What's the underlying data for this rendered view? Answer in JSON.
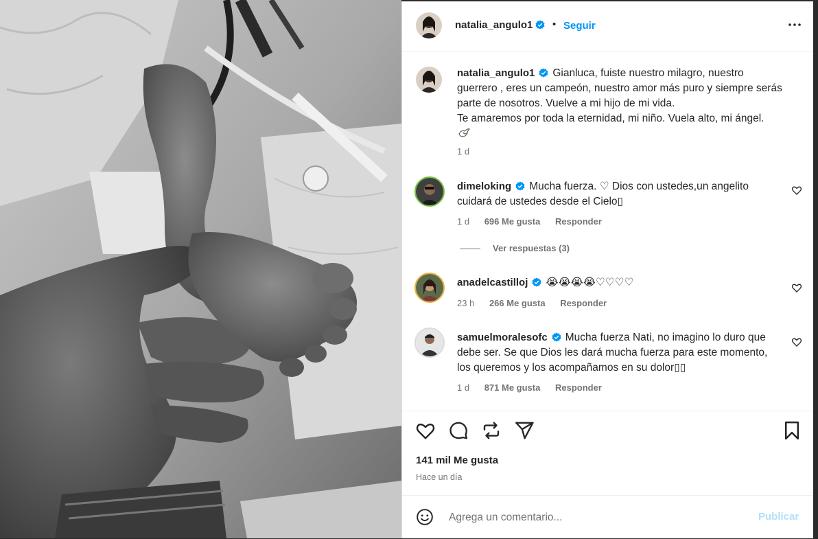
{
  "post": {
    "author": "natalia_angulo1",
    "follow_label": "Seguir",
    "separator": "•",
    "more_icon": "more-horizontal-icon"
  },
  "caption": {
    "author": "natalia_angulo1",
    "text": "Gianluca, fuiste nuestro milagro, nuestro guerrero , eres un campeón, nuestro amor más puro y siempre serás parte de nosotros. Vuelve a mi hijo de mi vida.\nTe amaremos por toda la eternidad, mi niño. Vuela alto, mi ángel.",
    "time": "1 d"
  },
  "comments": [
    {
      "user": "dimeloking",
      "text": "Mucha fuerza. ♡ Dios con ustedes,un angelito cuidará de ustedes desde el Cielo",
      "time": "1 d",
      "likes": "696 Me gusta",
      "reply": "Responder"
    },
    {
      "user": "anadelcastilloj",
      "text": "😭😭😭😭♡♡♡♡",
      "time": "23 h",
      "likes": "266 Me gusta",
      "reply": "Responder"
    },
    {
      "user": "samuelmoralesofc",
      "text": "Mucha fuerza Nati, no imagino lo duro que debe ser. Se que Dios les dará mucha fuerza para este momento, los queremos y los acompañamos en su dolor",
      "time": "1 d",
      "likes": "871 Me gusta",
      "reply": "Responder"
    }
  ],
  "view_replies": "Ver respuestas (3)",
  "footer": {
    "likes": "141 mil Me gusta",
    "time": "Hace un día"
  },
  "composer": {
    "placeholder": "Agrega un comentario...",
    "post_label": "Publicar"
  },
  "colors": {
    "accent": "#0095f6",
    "verified": "#0095f6",
    "muted": "#737373",
    "post_disabled": "#b2dffc"
  }
}
